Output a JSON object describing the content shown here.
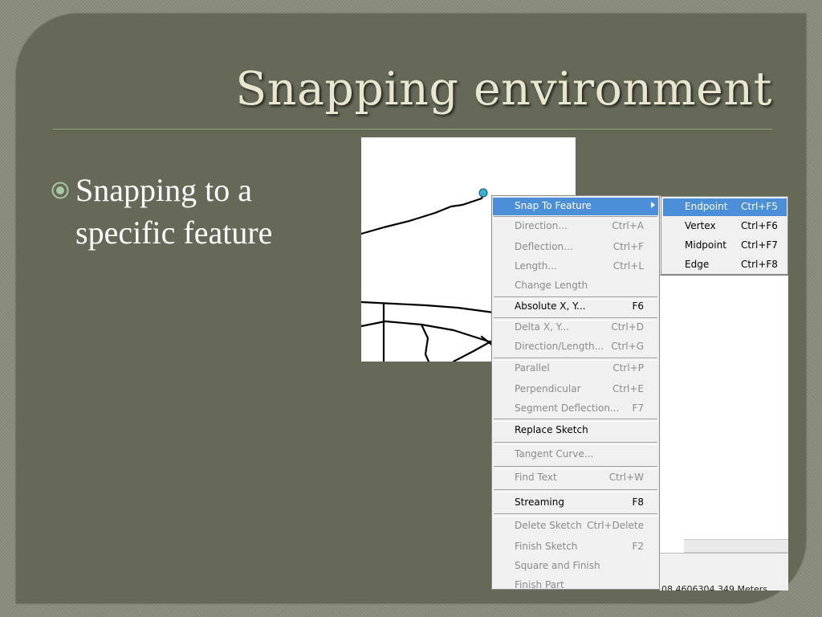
{
  "slide": {
    "title": "Snapping environment",
    "bullets": [
      {
        "text": "Snapping to a specific feature"
      }
    ]
  },
  "colors": {
    "frame": "#8a8c7c",
    "slide_background": "#666958",
    "title": "#e8e6cf",
    "bullet_text": "#ffffff",
    "menu_background": "#f0f0f0",
    "menu_highlight": "#4a8fd8",
    "menu_disabled_text": "#8b8b8b",
    "snap_point": "#35b3d6"
  },
  "icons": {
    "bullet": "circled-dot-icon",
    "submenu": "triangle-right-icon"
  },
  "context_menu": {
    "items": [
      {
        "label": "Snap To Feature",
        "shortcut": "",
        "state": "active",
        "has_submenu": true
      },
      {
        "label": "Direction...",
        "shortcut": "Ctrl+A",
        "state": "disabled"
      },
      {
        "label": "Deflection...",
        "shortcut": "Ctrl+F",
        "state": "disabled"
      },
      {
        "label": "Length...",
        "shortcut": "Ctrl+L",
        "state": "disabled"
      },
      {
        "label": "Change Length",
        "shortcut": "",
        "state": "disabled"
      },
      {
        "label": "Absolute X, Y...",
        "shortcut": "F6",
        "state": "enabled"
      },
      {
        "label": "Delta X, Y...",
        "shortcut": "Ctrl+D",
        "state": "disabled"
      },
      {
        "label": "Direction/Length...",
        "shortcut": "Ctrl+G",
        "state": "disabled"
      },
      {
        "label": "Parallel",
        "shortcut": "Ctrl+P",
        "state": "disabled"
      },
      {
        "label": "Perpendicular",
        "shortcut": "Ctrl+E",
        "state": "disabled"
      },
      {
        "label": "Segment Deflection...",
        "shortcut": "F7",
        "state": "disabled"
      },
      {
        "label": "Replace Sketch",
        "shortcut": "",
        "state": "enabled"
      },
      {
        "label": "Tangent Curve...",
        "shortcut": "",
        "state": "disabled"
      },
      {
        "label": "Find Text",
        "shortcut": "Ctrl+W",
        "state": "disabled"
      },
      {
        "label": "Streaming",
        "shortcut": "F8",
        "state": "enabled"
      },
      {
        "label": "Delete Sketch",
        "shortcut": "Ctrl+Delete",
        "state": "disabled"
      },
      {
        "label": "Finish Sketch",
        "shortcut": "F2",
        "state": "disabled"
      },
      {
        "label": "Square and Finish",
        "shortcut": "",
        "state": "disabled"
      },
      {
        "label": "Finish Part",
        "shortcut": "",
        "state": "disabled"
      }
    ]
  },
  "snap_submenu": {
    "items": [
      {
        "label": "Endpoint",
        "shortcut": "Ctrl+F5",
        "state": "active"
      },
      {
        "label": "Vertex",
        "shortcut": "Ctrl+F6",
        "state": "enabled"
      },
      {
        "label": "Midpoint",
        "shortcut": "Ctrl+F7",
        "state": "enabled"
      },
      {
        "label": "Edge",
        "shortcut": "Ctrl+F8",
        "state": "enabled"
      }
    ]
  },
  "status_bar": {
    "coordinates": "08  4606304.349 Meters"
  }
}
